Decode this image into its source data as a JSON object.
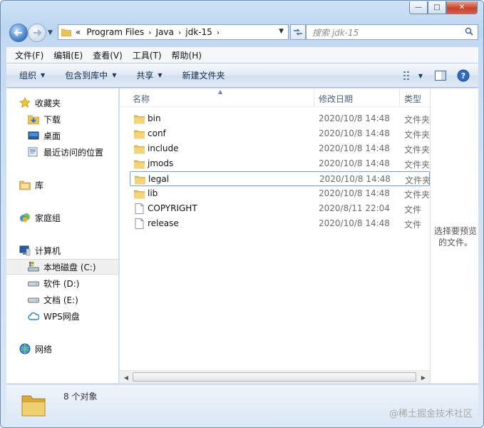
{
  "window": {
    "caption": {
      "minimize": "—",
      "maximize": "□",
      "close": "✕"
    }
  },
  "address": {
    "overflow": "«",
    "segments": [
      "Program Files",
      "Java",
      "jdk-15"
    ],
    "search_placeholder": "搜索 jdk-15"
  },
  "menu": [
    "文件(F)",
    "编辑(E)",
    "查看(V)",
    "工具(T)",
    "帮助(H)"
  ],
  "commands": [
    {
      "label": "组织",
      "dropdown": true
    },
    {
      "label": "包含到库中",
      "dropdown": true
    },
    {
      "label": "共享",
      "dropdown": true
    },
    {
      "label": "新建文件夹",
      "dropdown": false
    }
  ],
  "nav": {
    "favorites": {
      "label": "收藏夹",
      "items": [
        "下载",
        "桌面",
        "最近访问的位置"
      ]
    },
    "library": "库",
    "homegroup": "家庭组",
    "computer": {
      "label": "计算机",
      "items": [
        "本地磁盘 (C:)",
        "软件 (D:)",
        "文档 (E:)",
        "WPS网盘"
      ],
      "selected_index": 0
    },
    "network": "网络"
  },
  "columns": {
    "name": "名称",
    "date": "修改日期",
    "type": "类型"
  },
  "files": [
    {
      "name": "bin",
      "date": "2020/10/8 14:48",
      "type": "文件夹",
      "kind": "folder"
    },
    {
      "name": "conf",
      "date": "2020/10/8 14:48",
      "type": "文件夹",
      "kind": "folder"
    },
    {
      "name": "include",
      "date": "2020/10/8 14:48",
      "type": "文件夹",
      "kind": "folder"
    },
    {
      "name": "jmods",
      "date": "2020/10/8 14:48",
      "type": "文件夹",
      "kind": "folder"
    },
    {
      "name": "legal",
      "date": "2020/10/8 14:48",
      "type": "文件夹",
      "kind": "folder",
      "selected": true
    },
    {
      "name": "lib",
      "date": "2020/10/8 14:48",
      "type": "文件夹",
      "kind": "folder"
    },
    {
      "name": "COPYRIGHT",
      "date": "2020/8/11 22:04",
      "type": "文件",
      "kind": "file"
    },
    {
      "name": "release",
      "date": "2020/10/8 14:48",
      "type": "文件",
      "kind": "file"
    }
  ],
  "preview_text": "选择要预览的文件。",
  "status": {
    "count": "8 个对象"
  },
  "watermark": "@稀土掘金技术社区",
  "colors": {
    "folder": "#e8c35a",
    "selection_border": "#7da2ce",
    "accent": "#3a78c3"
  }
}
